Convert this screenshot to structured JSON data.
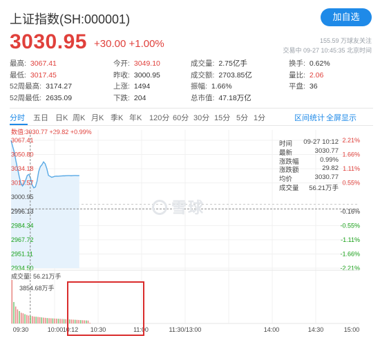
{
  "header": {
    "title": "上证指数(SH:000001)",
    "follow_button": "加自选",
    "price": "3030.95",
    "change": "+30.00 +1.00%",
    "followers": "155.59 万球友关注",
    "trade_time": "交易中 09-27 10:45:35 北京时间"
  },
  "stats": [
    [
      {
        "label": "最高:",
        "value": "3067.41",
        "color": "red"
      },
      {
        "label": "今开:",
        "value": "3049.10",
        "color": "red"
      },
      {
        "label": "成交量:",
        "value": "2.75亿手",
        "color": "normal"
      },
      {
        "label": "换手:",
        "value": "0.62%",
        "color": "normal"
      }
    ],
    [
      {
        "label": "最低:",
        "value": "3017.45",
        "color": "red"
      },
      {
        "label": "昨收:",
        "value": "3000.95",
        "color": "normal"
      },
      {
        "label": "成交额:",
        "value": "2703.85亿",
        "color": "normal"
      },
      {
        "label": "量比:",
        "value": "2.06",
        "color": "red"
      }
    ],
    [
      {
        "label": "52周最高:",
        "value": "3174.27",
        "color": "normal"
      },
      {
        "label": "上涨:",
        "value": "1494",
        "color": "normal"
      },
      {
        "label": "振幅:",
        "value": "1.66%",
        "color": "normal"
      },
      {
        "label": "平盘:",
        "value": "36",
        "color": "normal"
      }
    ],
    [
      {
        "label": "52周最低:",
        "value": "2635.09",
        "color": "normal"
      },
      {
        "label": "下跌:",
        "value": "204",
        "color": "normal"
      },
      {
        "label": "总市值:",
        "value": "47.18万亿",
        "color": "normal"
      }
    ]
  ],
  "tabs": [
    "分时",
    "五日",
    "日K",
    "周K",
    "月K",
    "季K",
    "年K",
    "120分",
    "60分",
    "30分",
    "15分",
    "5分",
    "1分"
  ],
  "tabs_right": [
    "区间统计",
    "全屏显示"
  ],
  "chart_info": "数值:3030.77 +29.82 +0.99%",
  "tooltip": [
    {
      "k": "时间",
      "v": "09-27 10:12"
    },
    {
      "k": "最新",
      "v": "3030.77"
    },
    {
      "k": "涨跌幅",
      "v": "0.99%"
    },
    {
      "k": "涨跌额",
      "v": "29.82"
    },
    {
      "k": "均价",
      "v": "3030.77"
    },
    {
      "k": "成交量",
      "v": "56.21万手"
    }
  ],
  "watermark": "雪球",
  "volume_label": "成交量: 56.21万手",
  "volume_max": "3854.68万手",
  "colors": {
    "up": "#e0403b",
    "down": "#1ba21b",
    "accent": "#1f8ae8",
    "line": "#58a9e5",
    "highlight": "#d92b2b"
  },
  "chart_data": {
    "type": "line",
    "y_left_ticks": [
      "3067.41",
      "3050.80",
      "3034.18",
      "3017.57",
      "3000.95",
      "2996.13",
      "2984.34",
      "2967.72",
      "2951.11",
      "2934.50"
    ],
    "y_right_ticks": [
      "2.21%",
      "1.66%",
      "1.11%",
      "0.55%",
      "",
      "-0.16%",
      "-0.55%",
      "-1.11%",
      "-1.66%",
      "-2.21%"
    ],
    "x_ticks": [
      "09:30",
      "10:00",
      "10:12",
      "10:30",
      "11:00",
      "11:30/13:00",
      "14:00",
      "14:30",
      "15:00"
    ],
    "x_minutes": [
      0,
      30,
      42,
      60,
      90,
      120,
      150,
      180,
      210,
      240
    ],
    "ylim": [
      2934.5,
      3067.41
    ],
    "prev_close": 3000.95,
    "crosshair": {
      "time_minutes": 42,
      "price": 2996.13
    },
    "series": [
      {
        "x": [
          0,
          1,
          2,
          3,
          4,
          5,
          6,
          7,
          8,
          9,
          10,
          11,
          12,
          13,
          14,
          15,
          16,
          17,
          18,
          19,
          20,
          21,
          22,
          23,
          24,
          25,
          26,
          27,
          28,
          29,
          30,
          31,
          32,
          33,
          34,
          35,
          36,
          37,
          38,
          39,
          40,
          41,
          42
        ],
        "values": [
          3067.4,
          3061,
          3055,
          3046,
          3038,
          3030,
          3023,
          3020,
          3022,
          3026,
          3031,
          3032,
          3028,
          3021,
          3018,
          3019,
          3025,
          3035,
          3040,
          3042,
          3045,
          3043,
          3038,
          3031,
          3030,
          3029,
          3029.5,
          3030,
          3030.2,
          3030.1,
          3030.3,
          3030.4,
          3030.5,
          3030.5,
          3030.6,
          3030.7,
          3030.7,
          3030.6,
          3030.7,
          3030.8,
          3030.8,
          3030.7,
          3030.77
        ]
      }
    ],
    "volume": [
      3854,
      1900,
      1500,
      1250,
      1100,
      950,
      900,
      820,
      760,
      700,
      680,
      650,
      610,
      600,
      580,
      560,
      540,
      520,
      500,
      480,
      470,
      460,
      450,
      440,
      430,
      420,
      410,
      400,
      390,
      380,
      370,
      360,
      350,
      340,
      330,
      320,
      310,
      300,
      290,
      280,
      270,
      260,
      56
    ]
  }
}
